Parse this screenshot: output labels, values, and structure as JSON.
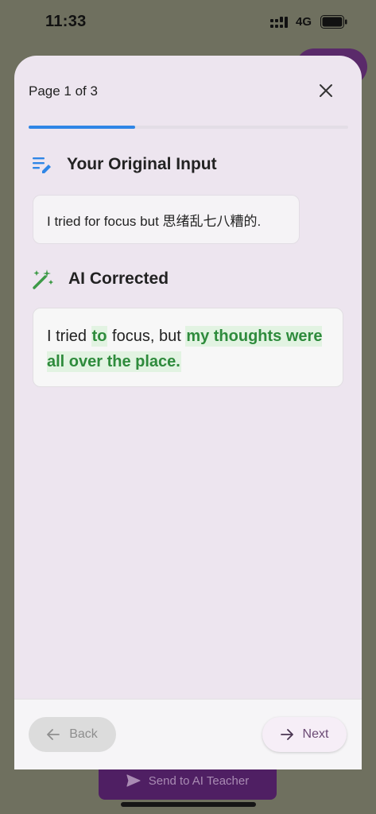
{
  "status_bar": {
    "time": "11:33",
    "network": "4G"
  },
  "sheet": {
    "page_label": "Page 1 of 3",
    "progress": {
      "current_page": 1,
      "total_pages": 3
    },
    "original_section": {
      "heading": "Your Original Input",
      "icon": "edit-note-icon",
      "text": "I tried for focus but 思绪乱七八糟的."
    },
    "corrected_section": {
      "heading": "AI Corrected",
      "icon": "magic-wand-icon",
      "segments": [
        {
          "text": "I tried ",
          "highlight": false
        },
        {
          "text": "to",
          "highlight": true
        },
        {
          "text": " focus, but ",
          "highlight": false
        },
        {
          "text": "my thoughts were all over the place.",
          "highlight": true
        }
      ]
    },
    "footer": {
      "back_label": "Back",
      "next_label": "Next"
    }
  },
  "background": {
    "send_button_label": "Send to AI Teacher"
  },
  "colors": {
    "accent_blue": "#2f86e6",
    "highlight_green": "#2e8b3c",
    "sheet_background": "#ede5ef"
  }
}
